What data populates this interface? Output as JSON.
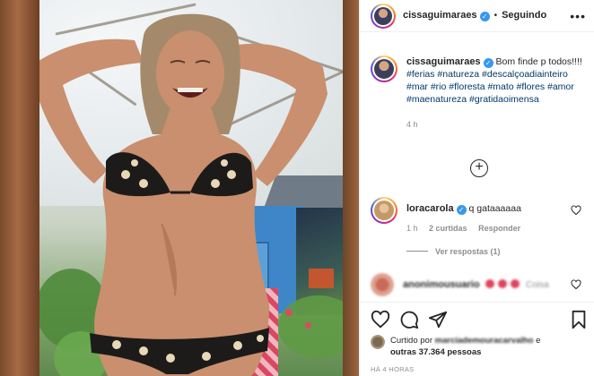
{
  "post": {
    "author": "cissaguimaraes",
    "follow_state": "Seguindo",
    "more_icon": "more-horizontal-icon"
  },
  "caption": {
    "author": "cissaguimaraes",
    "text": "Bom finde p todos!!!!",
    "hashtags": "#ferias #natureza #descalçoadiainteiro #mar #rio #floresta #mato #flores #amor #maenatureza #gratidaoimensa",
    "time": "4 h"
  },
  "load_more_icon": "plus-circle-icon",
  "comment": {
    "author": "loracarola",
    "text": "q gataaaaaa",
    "time": "1 h",
    "likes": "2 curtidas",
    "reply": "Responder",
    "view_replies": "Ver respostas (1)"
  },
  "blurred_comment": {
    "author": "anonimousuario",
    "text": "Coisa"
  },
  "actions": {
    "like_icon": "heart-icon",
    "comment_icon": "comment-icon",
    "share_icon": "send-icon",
    "save_icon": "bookmark-icon"
  },
  "likes": {
    "prefix": "Curtido por",
    "blurred_user": "marciademouracarvalho",
    "middle": "e",
    "count": "outras 37.364 pessoas"
  },
  "timestamp": "HÁ 4 HORAS",
  "colors": {
    "verified": "#3897f0",
    "hashtag": "#00376b",
    "muted": "#8e8e8e"
  }
}
